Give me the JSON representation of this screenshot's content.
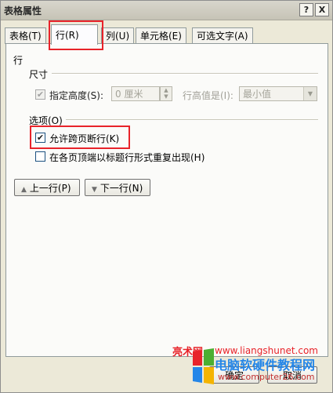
{
  "window": {
    "title": "表格属性",
    "help_glyph": "?",
    "close_glyph": "X"
  },
  "tabs": [
    {
      "label": "表格(T)"
    },
    {
      "label": "行(R)"
    },
    {
      "label": "列(U)"
    },
    {
      "label": "单元格(E)"
    },
    {
      "label": "可选文字(A)"
    }
  ],
  "panel": {
    "section_row": "行",
    "section_size": "尺寸",
    "specify_height_label": "指定高度(S):",
    "specify_height_value": "0 厘米",
    "row_height_is_label": "行高值是(I):",
    "row_height_is_value": "最小值",
    "options_label": "选项(O)",
    "allow_break_label": "允许跨页断行(K)",
    "allow_break_check": "✔",
    "repeat_header_label": "在各页顶端以标题行形式重复出现(H)",
    "prev_row_label": "上一行(P)",
    "next_row_label": "下一行(N)"
  },
  "footer": {
    "ok_label": "确定",
    "cancel_label": "取消"
  },
  "watermark": {
    "site_cn": "亮术网",
    "url1": "www.liangshunet.com",
    "site_name": "电脑软硬件教程网",
    "url2": "www.computer26.com"
  }
}
